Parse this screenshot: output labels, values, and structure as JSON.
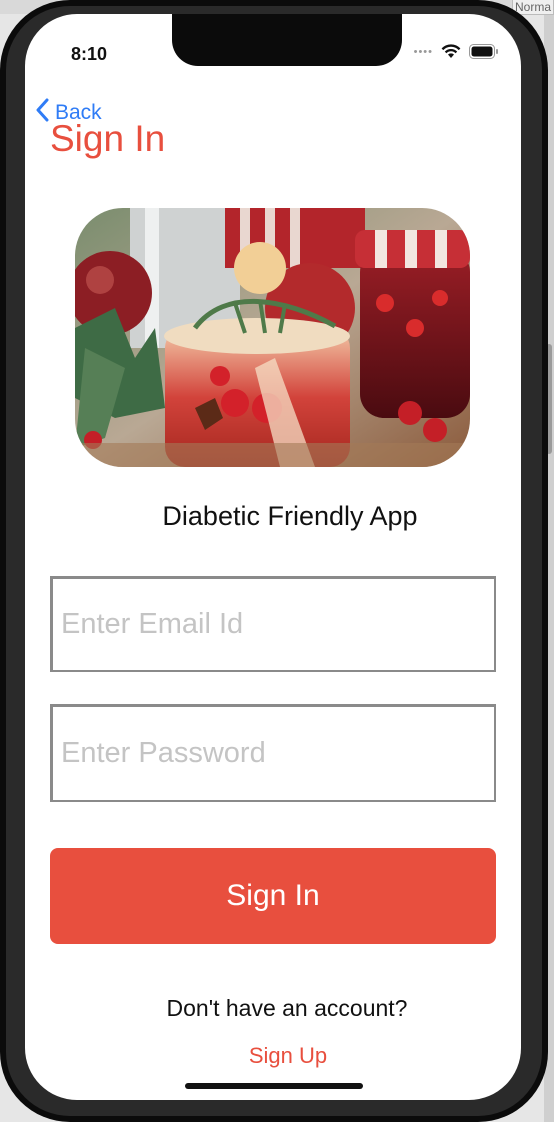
{
  "window": {
    "corner_label": "Norma"
  },
  "status_bar": {
    "time": "8:10"
  },
  "nav": {
    "back_label": "Back",
    "title": "Sign In"
  },
  "hero": {
    "alt": "Festive drinks with apples, cranberries and rosemary"
  },
  "app": {
    "name": "Diabetic Friendly App"
  },
  "form": {
    "email_placeholder": "Enter Email Id",
    "password_placeholder": "Enter Password",
    "submit_label": "Sign In"
  },
  "footer": {
    "prompt": "Don't have an account?",
    "signup_label": "Sign Up"
  },
  "colors": {
    "accent": "#e84f3e",
    "link": "#2f7cf6"
  }
}
